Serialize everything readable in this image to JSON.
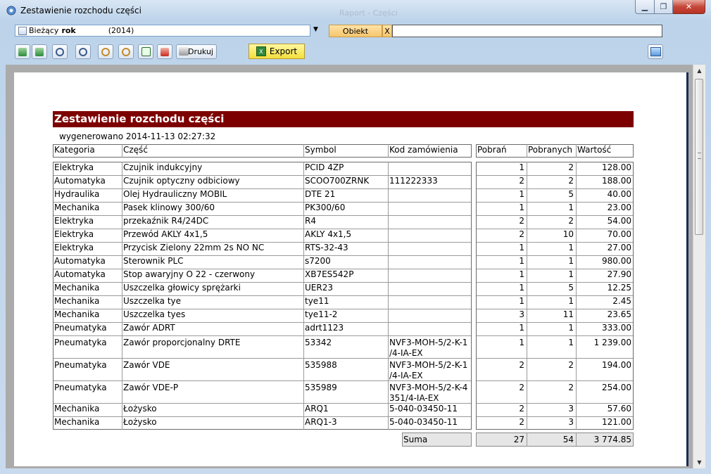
{
  "window": {
    "title": "Zestawienie rozchodu części",
    "ghost_title": "Raport - Części"
  },
  "toolbar": {
    "period_prefix": "Bieżący",
    "period_bold": "rok",
    "period_year": "(2014)",
    "obiekt_label": "Obiekt",
    "clear_label": "X",
    "obiekt_value": "",
    "print_label": "Drukuj",
    "export_label": "Export"
  },
  "report": {
    "title": "Zestawienie rozchodu części",
    "generated": "wygenerowano 2014-11-13 02:27:32",
    "headers": [
      "Kategoria",
      "Część",
      "Symbol",
      "Kod zamówienia",
      "Pobrań",
      "Pobranych",
      "Wartość"
    ],
    "rows": [
      {
        "kategoria": "Elektryka",
        "czesc": "Czujnik indukcyjny",
        "symbol": "PCID 4ZP",
        "kod": "",
        "kod2": "",
        "pobran": "1",
        "pobranych": "2",
        "wartosc": "128.00"
      },
      {
        "kategoria": "Automatyka",
        "czesc": "Czujnik optyczny odbiciowy",
        "symbol": "SCOO700ZRNK",
        "kod": "111222333",
        "kod2": "",
        "pobran": "2",
        "pobranych": "2",
        "wartosc": "188.00"
      },
      {
        "kategoria": "Hydraulika",
        "czesc": "Olej Hydrauliczny MOBIL",
        "symbol": "DTE 21",
        "kod": "",
        "kod2": "",
        "pobran": "1",
        "pobranych": "5",
        "wartosc": "40.00"
      },
      {
        "kategoria": "Mechanika",
        "czesc": "Pasek klinowy 300/60",
        "symbol": "PK300/60",
        "kod": "",
        "kod2": "",
        "pobran": "1",
        "pobranych": "1",
        "wartosc": "23.00"
      },
      {
        "kategoria": "Elektryka",
        "czesc": "przekaźnik R4/24DC",
        "symbol": "R4",
        "kod": "",
        "kod2": "",
        "pobran": "2",
        "pobranych": "2",
        "wartosc": "54.00"
      },
      {
        "kategoria": "Elektryka",
        "czesc": "Przewód AKLY 4x1,5",
        "symbol": "AKLY 4x1,5",
        "kod": "",
        "kod2": "",
        "pobran": "2",
        "pobranych": "10",
        "wartosc": "70.00"
      },
      {
        "kategoria": "Elektryka",
        "czesc": "Przycisk Zielony 22mm  2s NO NC",
        "symbol": "RTS-32-43",
        "kod": "",
        "kod2": "",
        "pobran": "1",
        "pobranych": "1",
        "wartosc": "27.00"
      },
      {
        "kategoria": "Automatyka",
        "czesc": "Sterownik PLC",
        "symbol": "s7200",
        "kod": "",
        "kod2": "",
        "pobran": "1",
        "pobranych": "1",
        "wartosc": "980.00"
      },
      {
        "kategoria": "Automatyka",
        "czesc": "Stop awaryjny O 22 - czerwony",
        "symbol": "XB7ES542P",
        "kod": "",
        "kod2": "",
        "pobran": "1",
        "pobranych": "1",
        "wartosc": "27.90"
      },
      {
        "kategoria": "Mechanika",
        "czesc": "Uszczelka głowicy sprężarki",
        "symbol": "UER23",
        "kod": "",
        "kod2": "",
        "pobran": "1",
        "pobranych": "5",
        "wartosc": "12.25"
      },
      {
        "kategoria": "Mechanika",
        "czesc": "Uszczelka tye",
        "symbol": "tye11",
        "kod": "",
        "kod2": "",
        "pobran": "1",
        "pobranych": "1",
        "wartosc": "2.45"
      },
      {
        "kategoria": "Mechanika",
        "czesc": "Uszczelka tyes",
        "symbol": "tye11-2",
        "kod": "",
        "kod2": "",
        "pobran": "3",
        "pobranych": "11",
        "wartosc": "23.65"
      },
      {
        "kategoria": "Pneumatyka",
        "czesc": "Zawór ADRT",
        "symbol": "adrt1123",
        "kod": "",
        "kod2": "",
        "pobran": "1",
        "pobranych": "1",
        "wartosc": "333.00"
      },
      {
        "kategoria": "Pneumatyka",
        "czesc": "Zawór proporcjonalny DRTE",
        "symbol": "53342",
        "kod": "NVF3-MOH-5/2-K-1",
        "kod2": "/4-IA-EX",
        "pobran": "1",
        "pobranych": "1",
        "wartosc": "1 239.00"
      },
      {
        "kategoria": "Pneumatyka",
        "czesc": "Zawór VDE",
        "symbol": "535988",
        "kod": "NVF3-MOH-5/2-K-1",
        "kod2": "/4-IA-EX",
        "pobran": "2",
        "pobranych": "2",
        "wartosc": "194.00"
      },
      {
        "kategoria": "Pneumatyka",
        "czesc": "Zawór VDE-P",
        "symbol": "535989",
        "kod": "NVF3-MOH-5/2-K-4",
        "kod2": "351/4-IA-EX",
        "pobran": "2",
        "pobranych": "2",
        "wartosc": "254.00"
      },
      {
        "kategoria": "Mechanika",
        "czesc": "Łożysko",
        "symbol": "ARQ1",
        "kod": "5-040-03450-11",
        "kod2": "",
        "pobran": "2",
        "pobranych": "3",
        "wartosc": "57.60"
      },
      {
        "kategoria": "Mechanika",
        "czesc": "Łożysko",
        "symbol": "ARQ1-3",
        "kod": "5-040-03450-11",
        "kod2": "",
        "pobran": "2",
        "pobranych": "3",
        "wartosc": "121.00"
      }
    ],
    "sum": {
      "label": "Suma",
      "pobran": "27",
      "pobranych": "54",
      "wartosc": "3 774.85"
    }
  }
}
